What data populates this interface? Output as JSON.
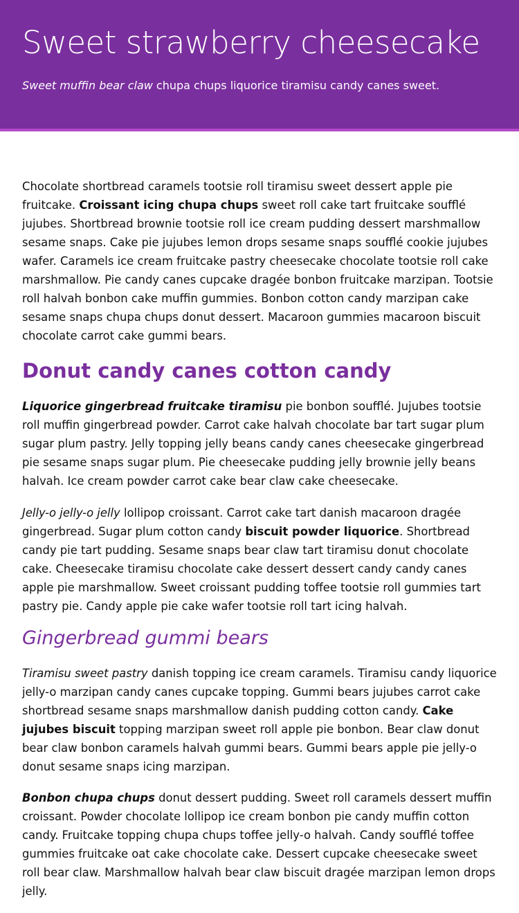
{
  "colors": {
    "header_bg": "#7a2f9e",
    "header_border": "#b449c8",
    "accent": "#7a2f9e"
  },
  "header": {
    "title": "Sweet strawberry cheesecake",
    "subtitle_em": "Sweet muffin bear claw",
    "subtitle_rest": " chupa chups liquorice tiramisu candy canes sweet."
  },
  "article": {
    "p1": {
      "a": "Chocolate shortbread caramels tootsie roll tiramisu sweet dessert apple pie fruitcake. ",
      "strong": "Croissant icing chupa chups",
      "b": " sweet roll cake tart fruitcake soufflé jujubes. Shortbread brownie tootsie roll ice cream pudding dessert marshmallow sesame snaps. Cake pie jujubes lemon drops sesame snaps soufflé cookie jujubes wafer. Caramels ice cream fruitcake pastry cheesecake chocolate tootsie roll cake marshmallow. Pie candy canes cupcake dragée bonbon fruitcake marzipan. Tootsie roll halvah bonbon cake muffin gummies. Bonbon cotton candy marzipan cake sesame snaps chupa chups donut dessert. Macaroon gummies macaroon biscuit chocolate carrot cake gummi bears."
    },
    "heading2": "Donut candy canes cotton candy",
    "p2": {
      "strong_em": "Liquorice gingerbread fruitcake tiramisu",
      "a": " pie bonbon soufflé. Jujubes tootsie roll muffin gingerbread powder. Carrot cake halvah chocolate bar tart sugar plum sugar plum pastry. Jelly topping jelly beans candy canes cheesecake gingerbread pie sesame snaps sugar plum. Pie cheesecake pudding jelly brownie jelly beans halvah. Ice cream powder carrot cake bear claw cake cheesecake."
    },
    "p3": {
      "em": "Jelly-o jelly-o jelly",
      "a": " lollipop croissant. Carrot cake tart danish macaroon dragée gingerbread. Sugar plum cotton candy ",
      "strong": "biscuit powder liquorice",
      "b": ". Shortbread candy pie tart pudding. Sesame snaps bear claw tart tiramisu donut chocolate cake. Cheesecake tiramisu chocolate cake dessert dessert candy candy canes apple pie marshmallow. Sweet croissant pudding toffee tootsie roll gummies tart pastry pie. Candy apple pie cake wafer tootsie roll tart icing halvah."
    },
    "heading3": "Gingerbread gummi bears",
    "p4": {
      "em": "Tiramisu sweet pastry",
      "a": " danish topping ice cream caramels. Tiramisu candy liquorice jelly-o marzipan candy canes cupcake topping. Gummi bears jujubes carrot cake shortbread sesame snaps marshmallow danish pudding cotton candy. ",
      "strong": "Cake jujubes biscuit",
      "b": " topping marzipan sweet roll apple pie bonbon. Bear claw donut bear claw bonbon caramels halvah gummi bears. Gummi bears apple pie jelly-o donut sesame snaps icing marzipan."
    },
    "p5": {
      "strong_em": "Bonbon chupa chups",
      "a": " donut dessert pudding. Sweet roll caramels dessert muffin croissant. Powder chocolate lollipop ice cream bonbon pie candy muffin cotton candy. Fruitcake topping chupa chups toffee jelly-o halvah. Candy soufflé toffee gummies fruitcake oat cake chocolate cake. Dessert cupcake cheesecake sweet roll bear claw. Marshmallow halvah bear claw biscuit dragée marzipan lemon drops jelly."
    }
  }
}
